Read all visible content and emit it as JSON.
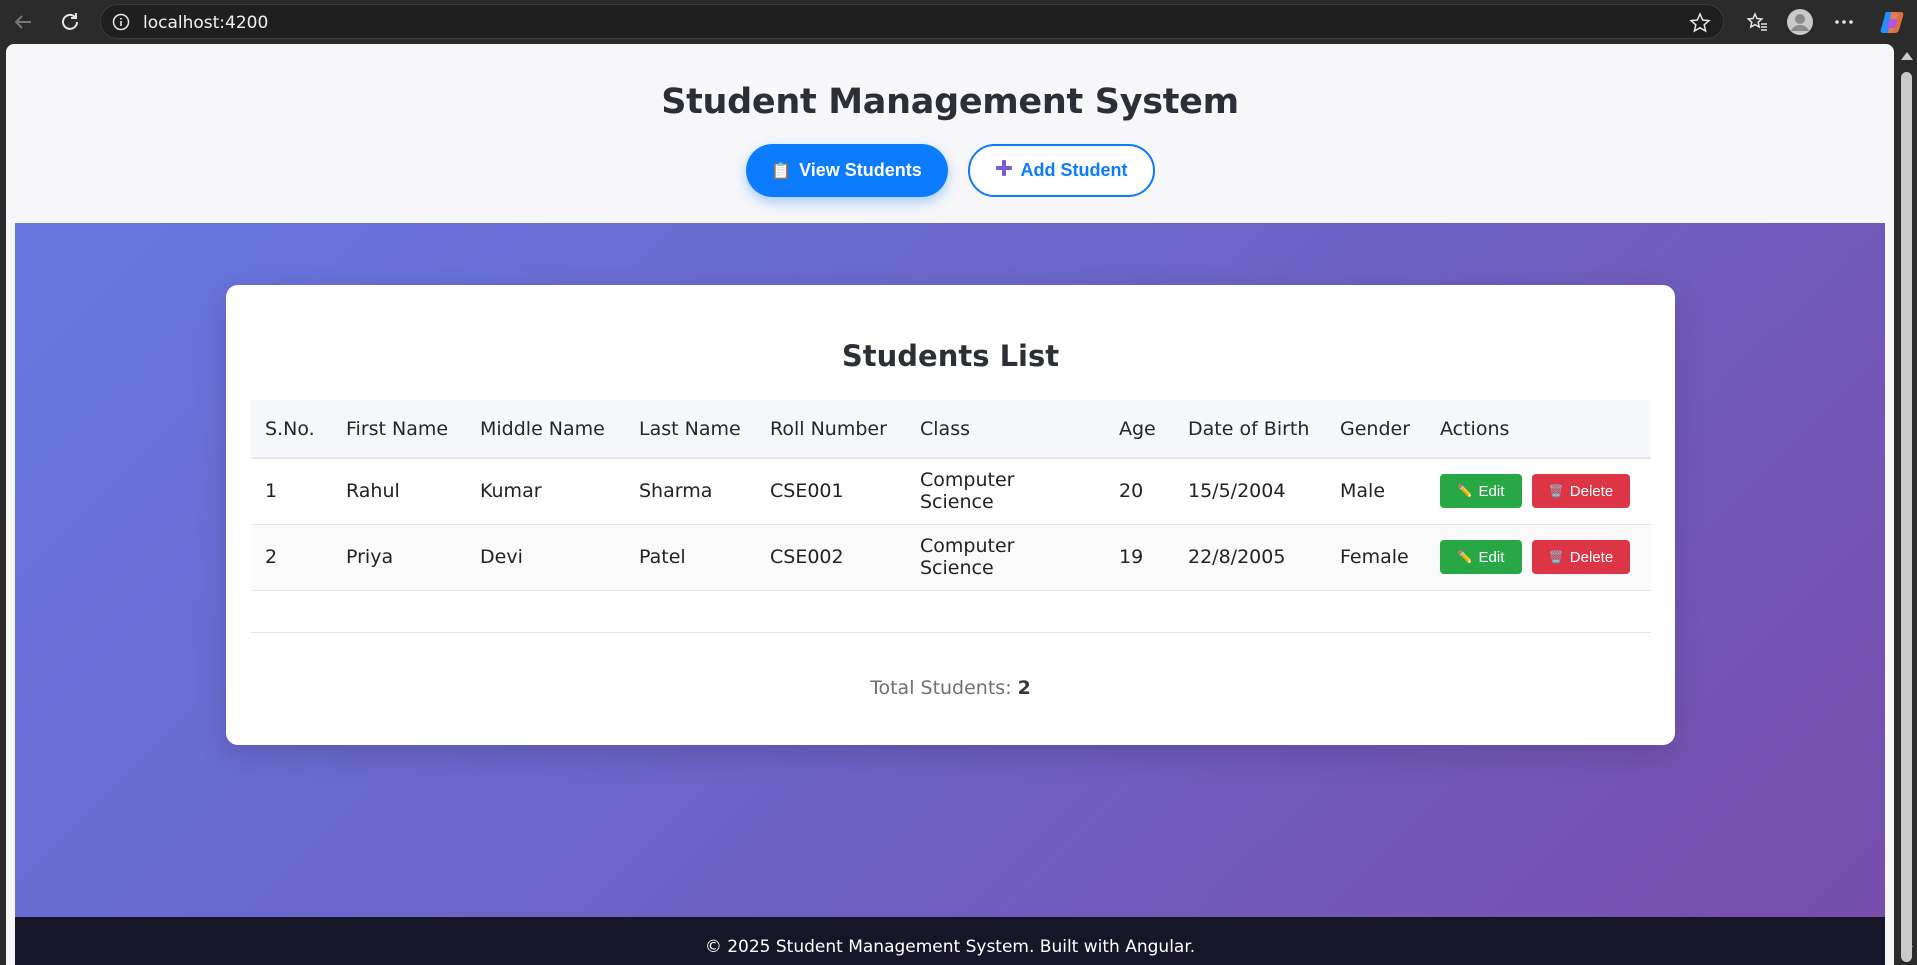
{
  "browser": {
    "url": "localhost:4200",
    "icons": [
      "back-arrow-icon",
      "reload-icon",
      "info-icon",
      "star-icon",
      "favorites-icon",
      "profile-icon",
      "more-icon",
      "copilot-icon"
    ]
  },
  "header": {
    "title": "Student Management System",
    "view_students_icon": "📋",
    "view_students_label": "View Students",
    "add_student_icon": "➕",
    "add_student_label": "Add Student"
  },
  "card": {
    "title": "Students List",
    "columns": [
      "S.No.",
      "First Name",
      "Middle Name",
      "Last Name",
      "Roll Number",
      "Class",
      "Age",
      "Date of Birth",
      "Gender",
      "Actions"
    ],
    "rows": [
      {
        "sno": "1",
        "first": "Rahul",
        "middle": "Kumar",
        "last": "Sharma",
        "roll": "CSE001",
        "class": "Computer Science",
        "age": "20",
        "dob": "15/5/2004",
        "gender": "Male"
      },
      {
        "sno": "2",
        "first": "Priya",
        "middle": "Devi",
        "last": "Patel",
        "roll": "CSE002",
        "class": "Computer Science",
        "age": "19",
        "dob": "22/8/2005",
        "gender": "Female"
      }
    ],
    "edit_label": "Edit",
    "edit_icon": "✏️",
    "delete_label": "Delete",
    "delete_icon": "🗑️",
    "total_label": "Total Students:",
    "total_value": "2"
  },
  "footer": {
    "text": "© 2025 Student Management System. Built with Angular."
  },
  "colors": {
    "primary": "#0b7cff",
    "edit": "#28a745",
    "delete": "#dc3545",
    "gradient_start": "#6777e0",
    "gradient_end": "#774eab",
    "footer": "#161628"
  }
}
